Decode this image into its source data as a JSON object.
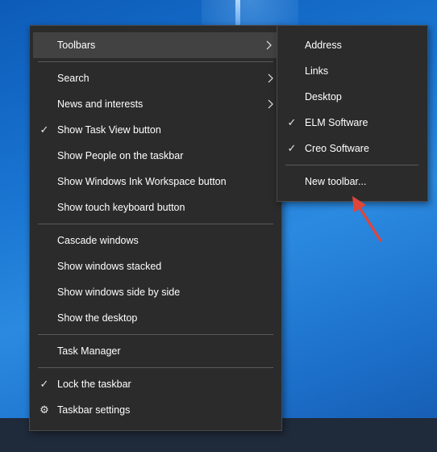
{
  "main_menu": {
    "toolbars": "Toolbars",
    "search": "Search",
    "news": "News and interests",
    "task_view": "Show Task View button",
    "people": "Show People on the taskbar",
    "ink": "Show Windows Ink Workspace button",
    "touch_kb": "Show touch keyboard button",
    "cascade": "Cascade windows",
    "stacked": "Show windows stacked",
    "side_by_side": "Show windows side by side",
    "desktop": "Show the desktop",
    "task_manager": "Task Manager",
    "lock": "Lock the taskbar",
    "settings": "Taskbar settings"
  },
  "toolbars_submenu": {
    "address": "Address",
    "links": "Links",
    "desktop": "Desktop",
    "elm": "ELM Software",
    "creo": "Creo Software",
    "new_toolbar": "New toolbar..."
  },
  "checked_items": [
    "Show Task View button",
    "Lock the taskbar",
    "ELM Software",
    "Creo Software"
  ],
  "colors": {
    "menu_background": "#2b2b2b",
    "highlight": "#424242",
    "separator": "#5a5a5a",
    "annotation_arrow": "#e0453a"
  },
  "icons": [
    "checkmark-icon",
    "chevron-right-icon",
    "gear-icon",
    "annotation-arrow"
  ]
}
